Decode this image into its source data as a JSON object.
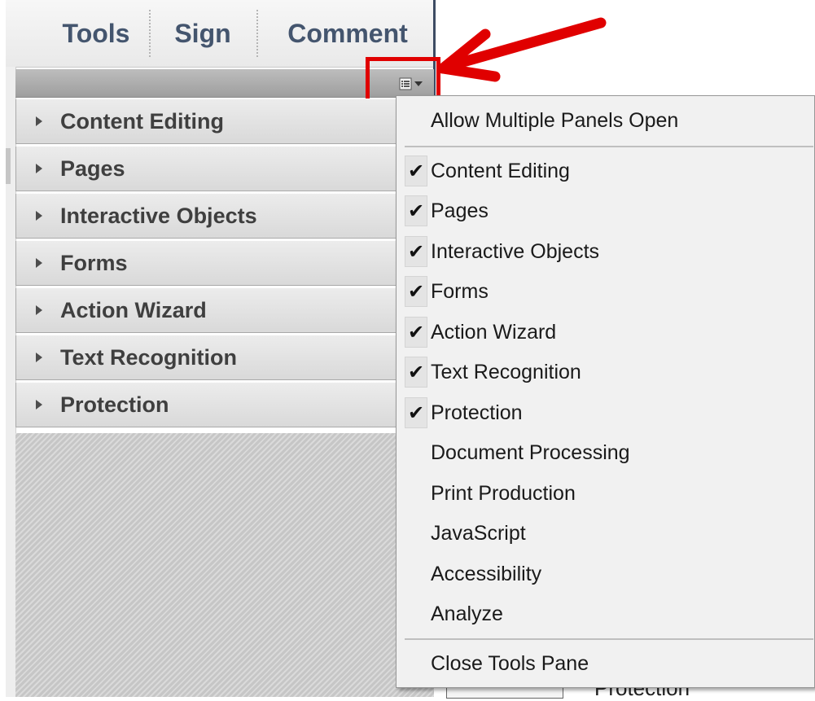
{
  "tabs": [
    "Tools",
    "Sign",
    "Comment"
  ],
  "panels": [
    "Content Editing",
    "Pages",
    "Interactive Objects",
    "Forms",
    "Action Wizard",
    "Text Recognition",
    "Protection"
  ],
  "menu": {
    "top_item": "Allow Multiple Panels Open",
    "items": [
      {
        "label": "Content Editing",
        "checked": true
      },
      {
        "label": "Pages",
        "checked": true
      },
      {
        "label": "Interactive Objects",
        "checked": true
      },
      {
        "label": "Forms",
        "checked": true
      },
      {
        "label": "Action Wizard",
        "checked": true
      },
      {
        "label": "Text Recognition",
        "checked": true
      },
      {
        "label": "Protection",
        "checked": true
      },
      {
        "label": "Document Processing",
        "checked": false
      },
      {
        "label": "Print Production",
        "checked": false
      },
      {
        "label": "JavaScript",
        "checked": false
      },
      {
        "label": "Accessibility",
        "checked": false
      },
      {
        "label": "Analyze",
        "checked": false
      }
    ],
    "bottom_item": "Close Tools Pane"
  },
  "check_glyph": "✔",
  "background_text": "Protection",
  "colors": {
    "annotation": "#e00000",
    "tab_text": "#44556e"
  }
}
